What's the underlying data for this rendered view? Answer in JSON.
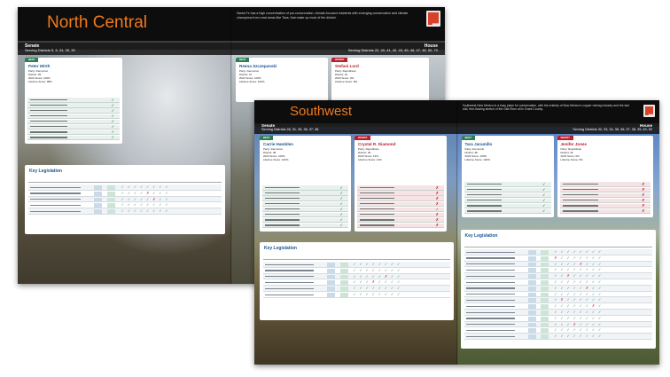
{
  "back_spread": {
    "region": "North Central",
    "intro_text": "Santa Fe has a high concentration of pro-conservation, climate-focused residents with emerging conservation and climate champions from rural areas like Taos, that make up most of the district.",
    "senate": {
      "label": "Senate",
      "districts": "Serving Districts 5, 6, 24, 25, 39"
    },
    "house": {
      "label": "House",
      "districts": "Serving Districts 22, 40, 41, 42, 43, 45, 46, 47, 48, 50, 70"
    },
    "senate_best": {
      "tag": "BEST",
      "name": "Peter Wirth",
      "meta": [
        "Party: Democrat",
        "District: 25",
        "2023 Score: 100%",
        "Lifetime Score: 98%"
      ]
    },
    "house_best": {
      "tag": "BEST",
      "name": "Reena Szczepanski",
      "meta": [
        "Party: Democrat",
        "District: 47",
        "2023 Score: 100%",
        "Lifetime Score: 100%"
      ]
    },
    "house_worst": {
      "tag": "WORST",
      "name": "Stefani Lord",
      "meta": [
        "Party: Republican",
        "District: 22",
        "2023 Score: 0%",
        "Lifetime Score: 8%"
      ]
    },
    "key_legislation_title": "Key Legislation"
  },
  "front_spread": {
    "region": "Southwest",
    "intro_text": "Southwest New Mexico is a busy place for conservation, with the entirety of New Mexico's copper mining industry and the last wild, free-flowing stretch of the Gila River all in Grant County.",
    "senate": {
      "label": "Senate",
      "districts": "Serving Districts 28, 31, 35, 36, 37, 38"
    },
    "house": {
      "label": "House",
      "districts": "Serving Districts 32, 33, 34, 35, 36, 37, 38, 39, 49, 52"
    },
    "senate_best": {
      "tag": "BEST",
      "name": "Carrie Hamblen",
      "meta": [
        "Party: Democrat",
        "District: 38",
        "2023 Score: 100%",
        "Lifetime Score: 100%"
      ]
    },
    "senate_worst": {
      "tag": "WORST",
      "name": "Crystal R. Diamond",
      "meta": [
        "Party: Republican",
        "District: 35",
        "2023 Score: 13%",
        "Lifetime Score: 14%"
      ]
    },
    "house_best": {
      "tag": "BEST",
      "name": "Tara Jaramillo",
      "meta": [
        "Party: Democrat",
        "District: 38",
        "2023 Score: 100%",
        "Lifetime Score: 100%"
      ]
    },
    "house_worst": {
      "tag": "WORST",
      "name": "Jenifer Jones",
      "meta": [
        "Party: Republican",
        "District: 32",
        "2023 Score: 0%",
        "Lifetime Score: 0%"
      ]
    },
    "key_legislation_title": "Key Legislation"
  },
  "icons": [
    "new-mexico-state-icon",
    "checkmark-icon",
    "x-mark-icon",
    "caret-up-icon"
  ],
  "colors": {
    "title_orange": "#f07a1c",
    "best_green": "#2f7d56",
    "worst_red": "#b7202e",
    "name_blue": "#1c5590",
    "topbar": "#0d0d0d"
  }
}
